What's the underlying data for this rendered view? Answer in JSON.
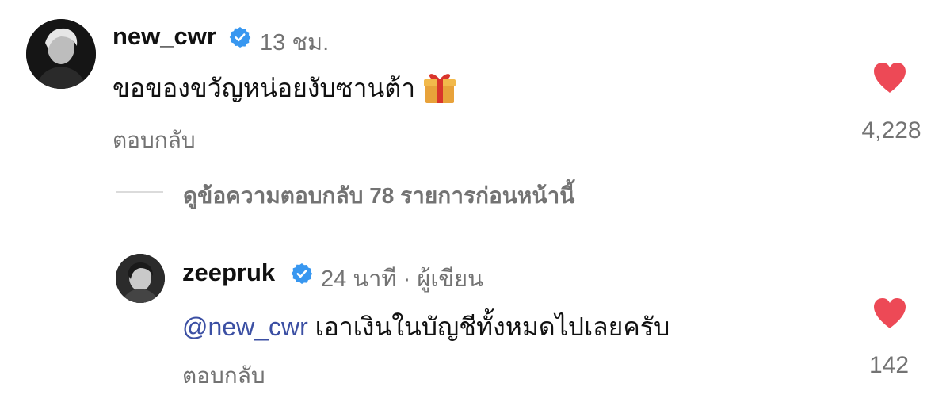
{
  "comments": [
    {
      "username": "new_cwr",
      "time": "13 ชม.",
      "text": "ขอของขวัญหน่อยงับซานต้า",
      "emoji": "🎁",
      "reply_label": "ตอบกลับ",
      "likes": "4,228"
    }
  ],
  "view_replies_label": "ดูข้อความตอบกลับ 78 รายการก่อนหน้านี้",
  "reply": {
    "username": "zeepruk",
    "time": "24 นาที",
    "separator": "·",
    "role": "ผู้เขียน",
    "mention": "@new_cwr",
    "text": " เอาเงินในบัญชีทั้งหมดไปเลยครับ",
    "reply_label": "ตอบกลับ",
    "likes": "142"
  },
  "colors": {
    "heart": "#ed4956",
    "verified": "#3897f0",
    "mention": "#3b4fa3",
    "muted": "#737373"
  },
  "icons": [
    "verified-badge-icon",
    "heart-icon",
    "gift-emoji"
  ]
}
